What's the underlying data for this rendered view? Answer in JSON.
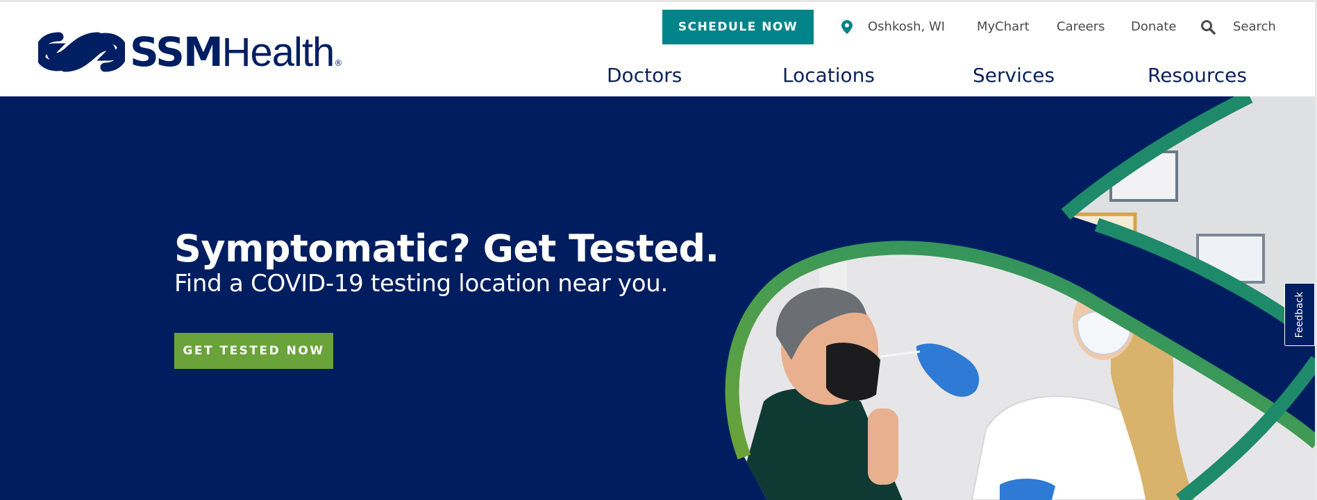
{
  "header": {
    "logo": {
      "brand_bold": "SSM",
      "brand_light": "Health",
      "registered": "®"
    },
    "schedule_button": "SCHEDULE NOW",
    "location": {
      "label": "Oshkosh, WI",
      "icon": "map-pin-icon"
    },
    "utility_links": {
      "mychart": "MyChart",
      "careers": "Careers",
      "donate": "Donate",
      "search": "Search"
    },
    "search_icon": "search-icon",
    "main_nav": [
      "Doctors",
      "Locations",
      "Services",
      "Resources"
    ]
  },
  "hero": {
    "title": "Symptomatic? Get Tested.",
    "subtitle": "Find a COVID-19 testing location near you.",
    "cta_button": "GET TESTED NOW"
  },
  "feedback_tab": "Feedback",
  "colors": {
    "navy": "#001e5f",
    "teal": "#00848a",
    "green": "#6aa339",
    "nav_text": "#0a2259"
  }
}
